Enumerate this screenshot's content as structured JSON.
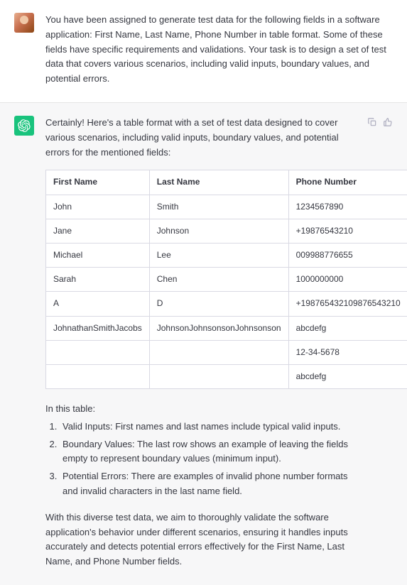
{
  "user_message": {
    "text": "You have been assigned to generate test data for the following fields in a software application: First Name, Last Name, Phone Number in table format. Some of these fields have specific requirements and validations. Your task is to design a set of test data that covers various scenarios, including valid inputs, boundary values, and potential errors."
  },
  "assistant_message": {
    "intro": "Certainly! Here's a table format with a set of test data designed to cover various scenarios, including valid inputs, boundary values, and potential errors for the mentioned fields:",
    "table": {
      "headers": [
        "First Name",
        "Last Name",
        "Phone Number"
      ],
      "rows": [
        [
          "John",
          "Smith",
          "1234567890"
        ],
        [
          "Jane",
          "Johnson",
          "+19876543210"
        ],
        [
          "Michael",
          "Lee",
          "009988776655"
        ],
        [
          "Sarah",
          "Chen",
          "1000000000"
        ],
        [
          "A",
          "D",
          "+198765432109876543210"
        ],
        [
          "JohnathanSmithJacobs",
          "JohnsonJohnsonsonJohnsonson",
          "abcdefg"
        ],
        [
          "",
          "",
          "12-34-5678"
        ],
        [
          "",
          "",
          "abcdefg"
        ]
      ]
    },
    "list_intro": "In this table:",
    "list_items": [
      "Valid Inputs: First names and last names include typical valid inputs.",
      "Boundary Values: The last row shows an example of leaving the fields empty to represent boundary values (minimum input).",
      "Potential Errors: There are examples of invalid phone number formats and invalid characters in the last name field."
    ],
    "closing": "With this diverse test data, we aim to thoroughly validate the software application's behavior under different scenarios, ensuring it handles inputs accurately and detects potential errors effectively for the First Name, Last Name, and Phone Number fields."
  }
}
